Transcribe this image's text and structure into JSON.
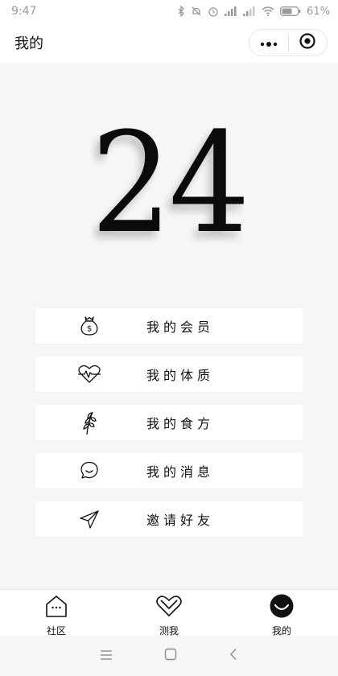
{
  "status_bar": {
    "time": "9:47",
    "battery_percent": "61%"
  },
  "nav": {
    "title": "我的"
  },
  "hero": {
    "number": "24"
  },
  "menu": {
    "items": [
      {
        "label": "我的会员",
        "icon": "money-bag-icon"
      },
      {
        "label": "我的体质",
        "icon": "heart-pulse-icon"
      },
      {
        "label": "我的食方",
        "icon": "wheat-icon"
      },
      {
        "label": "我的消息",
        "icon": "chat-bubble-icon"
      },
      {
        "label": "邀请好友",
        "icon": "paper-plane-icon"
      }
    ]
  },
  "tabs": [
    {
      "label": "社区",
      "icon": "house-icon"
    },
    {
      "label": "测我",
      "icon": "heart-outline-icon"
    },
    {
      "label": "我的",
      "icon": "smile-circle-icon",
      "active": true
    }
  ]
}
